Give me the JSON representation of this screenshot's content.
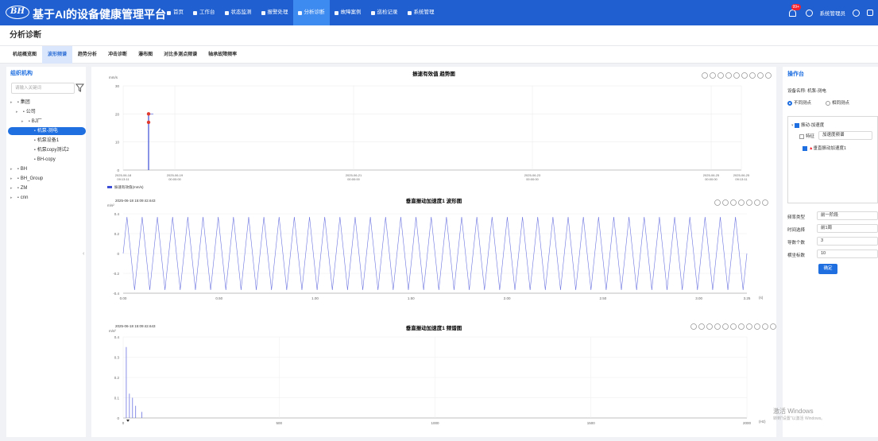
{
  "app": {
    "logo_text": "BH",
    "title": "基于AI的设备健康管理平台"
  },
  "nav": [
    {
      "label": "首页"
    },
    {
      "label": "工作台"
    },
    {
      "label": "状态监测"
    },
    {
      "label": "报警处理"
    },
    {
      "label": "分析诊断",
      "active": true
    },
    {
      "label": "故障案例"
    },
    {
      "label": "巡检记录"
    },
    {
      "label": "系统管理"
    }
  ],
  "topright": {
    "badge": "99+",
    "user": "系统管理员"
  },
  "page_title": "分析诊断",
  "tabs": [
    "机组概览图",
    "波形频谱",
    "趋势分析",
    "冲击诊断",
    "瀑布图",
    "对比多测点频谱",
    "轴承故障频率"
  ],
  "active_tab": 1,
  "left": {
    "heading": "组织机构",
    "search_placeholder": "请输入关键词",
    "tree": [
      {
        "label": "集团",
        "level": 0
      },
      {
        "label": "公司",
        "level": 1
      },
      {
        "label": "BJ厂",
        "level": 2
      },
      {
        "label": "机泵-测电",
        "level": 3,
        "selected": true
      },
      {
        "label": "机泵设备1",
        "level": 3
      },
      {
        "label": "机泵copy测试2",
        "level": 3
      },
      {
        "label": "BH-copy",
        "level": 3
      },
      {
        "label": "BH",
        "level": 0
      },
      {
        "label": "BH_Group",
        "level": 0
      },
      {
        "label": "ZM",
        "level": 0
      },
      {
        "label": "cnn",
        "level": 0
      }
    ]
  },
  "charts": {
    "trend": {
      "title": "振速有效值  趋势图",
      "ylabel": "mm/s",
      "ymax": 30,
      "yticks": [
        "30",
        "20",
        "10",
        "0"
      ],
      "xticks": [
        "2025-06-18\n09:13:11",
        "2025-06-19\n00:00:00",
        "2025-06-21\n00:00:00",
        "2025-06-23\n00:00:00",
        "2025-06-25\n00:00:00",
        "2025-06-25\n09:13:11"
      ],
      "legend": "振速有效值(mm/s)",
      "points": [
        20,
        17
      ]
    },
    "waveform": {
      "title": "垂直振动加速度1  波形图",
      "timestamp": "2025-06-18 15:09:42.643",
      "ylabel": "m/s²",
      "yticks": [
        "0.4",
        "0.2",
        "0",
        "-0.2",
        "-0.4"
      ],
      "xticks": [
        "0.00",
        "0.50",
        "1.00",
        "1.50",
        "2.00",
        "2.50",
        "3.00",
        "3.25"
      ],
      "xunit": "(s)",
      "cycles": 41
    },
    "spectrum": {
      "title": "垂直振动加速度1  频谱图",
      "timestamp": "2025-06-18 15:09:42.643",
      "ylabel": "m/s²",
      "yticks": [
        "0.4",
        "0.3",
        "0.2",
        "0.1",
        "0"
      ],
      "xticks": [
        "0",
        "500",
        "1000",
        "1500",
        "2000"
      ],
      "xunit": "(Hz)",
      "peaks": [
        [
          10,
          0.35
        ],
        [
          20,
          0.12
        ],
        [
          30,
          0.1
        ],
        [
          40,
          0.06
        ],
        [
          60,
          0.03
        ]
      ]
    }
  },
  "right": {
    "heading": "操作台",
    "device_label": "设备名称:",
    "device_value": "机泵-测电",
    "radio1": "不同测点",
    "radio2": "相同测点",
    "tree_group": "振动-加速度",
    "feature_label": "特征",
    "feature_value": "加速度频谱",
    "point_label": "垂直振动加速度1",
    "fields": [
      {
        "label": "频率类型",
        "value": "前一阶段"
      },
      {
        "label": "时间选择",
        "value": "前1周"
      },
      {
        "label": "导数个数",
        "value": "3"
      },
      {
        "label": "横坐标数",
        "value": "10"
      }
    ],
    "confirm": "确定"
  },
  "watermark": {
    "line1": "激活 Windows",
    "line2": "转到\"设置\"以激活 Windows。"
  }
}
